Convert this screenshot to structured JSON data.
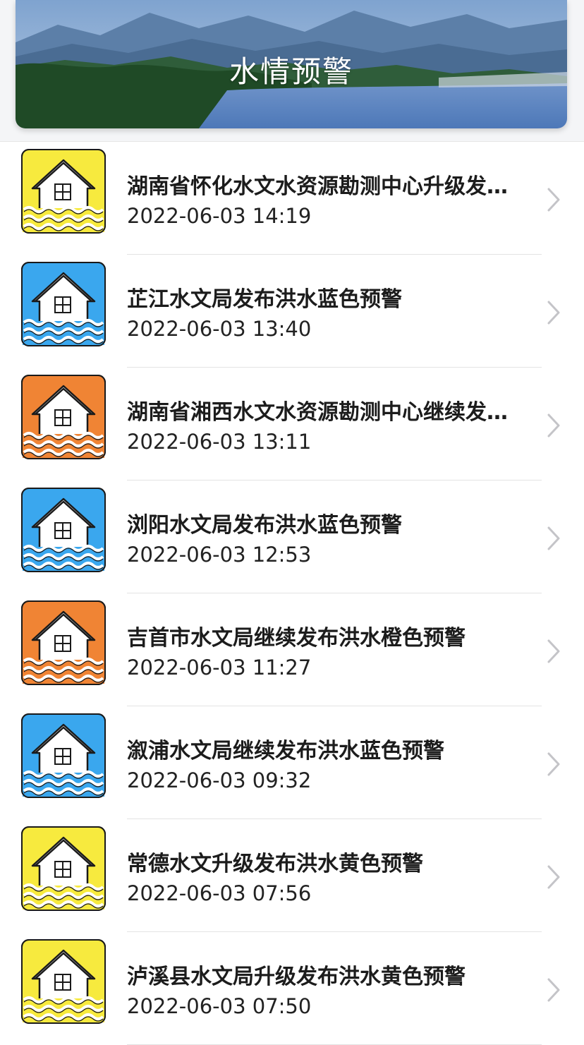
{
  "header": {
    "title": "水情预警"
  },
  "items": [
    {
      "title": "湖南省怀化水文水资源勘测中心升级发布洪水黄色预警",
      "time": "2022-06-03 14:19",
      "level_color": "#f7ea3e",
      "icon": "flooded-house-icon"
    },
    {
      "title": "芷江水文局发布洪水蓝色预警",
      "time": "2022-06-03 13:40",
      "level_color": "#3aa7ee",
      "icon": "flooded-house-icon"
    },
    {
      "title": "湖南省湘西水文水资源勘测中心继续发布洪水橙色预警",
      "time": "2022-06-03 13:11",
      "level_color": "#f08434",
      "icon": "flooded-house-icon"
    },
    {
      "title": "浏阳水文局发布洪水蓝色预警",
      "time": "2022-06-03 12:53",
      "level_color": "#3aa7ee",
      "icon": "flooded-house-icon"
    },
    {
      "title": "吉首市水文局继续发布洪水橙色预警",
      "time": "2022-06-03 11:27",
      "level_color": "#f08434",
      "icon": "flooded-house-icon"
    },
    {
      "title": "溆浦水文局继续发布洪水蓝色预警",
      "time": "2022-06-03 09:32",
      "level_color": "#3aa7ee",
      "icon": "flooded-house-icon"
    },
    {
      "title": "常德水文升级发布洪水黄色预警",
      "time": "2022-06-03 07:56",
      "level_color": "#f7ea3e",
      "icon": "flooded-house-icon"
    },
    {
      "title": "泸溪县水文局升级发布洪水黄色预警",
      "time": "2022-06-03 07:50",
      "level_color": "#f7ea3e",
      "icon": "flooded-house-icon"
    }
  ]
}
